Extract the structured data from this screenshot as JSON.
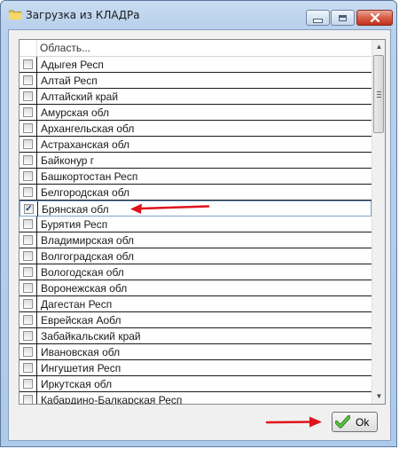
{
  "window": {
    "title": "Загрузка из КЛАДРа",
    "icons": {
      "app": "folder-icon",
      "minimize": "minimize-icon",
      "maximize": "maximize-icon",
      "close": "close-icon"
    }
  },
  "grid": {
    "column_header": "Область...",
    "rows": [
      {
        "label": "Адыгея Респ",
        "checked": false
      },
      {
        "label": "Алтай Респ",
        "checked": false
      },
      {
        "label": "Алтайский край",
        "checked": false
      },
      {
        "label": "Амурская обл",
        "checked": false
      },
      {
        "label": "Архангельская обл",
        "checked": false
      },
      {
        "label": "Астраханская обл",
        "checked": false
      },
      {
        "label": "Байконур г",
        "checked": false
      },
      {
        "label": "Башкортостан Респ",
        "checked": false
      },
      {
        "label": "Белгородская обл",
        "checked": false
      },
      {
        "label": "Брянская обл",
        "checked": true,
        "selected": true
      },
      {
        "label": "Бурятия Респ",
        "checked": false
      },
      {
        "label": "Владимирская обл",
        "checked": false
      },
      {
        "label": "Волгоградская обл",
        "checked": false
      },
      {
        "label": "Вологодская обл",
        "checked": false
      },
      {
        "label": "Воронежская обл",
        "checked": false
      },
      {
        "label": "Дагестан Респ",
        "checked": false
      },
      {
        "label": "Еврейская Аобл",
        "checked": false
      },
      {
        "label": "Забайкальский край",
        "checked": false
      },
      {
        "label": "Ивановская обл",
        "checked": false
      },
      {
        "label": "Ингушетия Респ",
        "checked": false
      },
      {
        "label": "Иркутская обл",
        "checked": false
      },
      {
        "label": "Кабардино-Балкарская Респ",
        "checked": false
      }
    ]
  },
  "ok_button": {
    "label": "Ok",
    "icon": "checkmark-icon"
  },
  "colors": {
    "annotation_arrow": "#e0141b",
    "check_icon": "#2f9e1f"
  }
}
